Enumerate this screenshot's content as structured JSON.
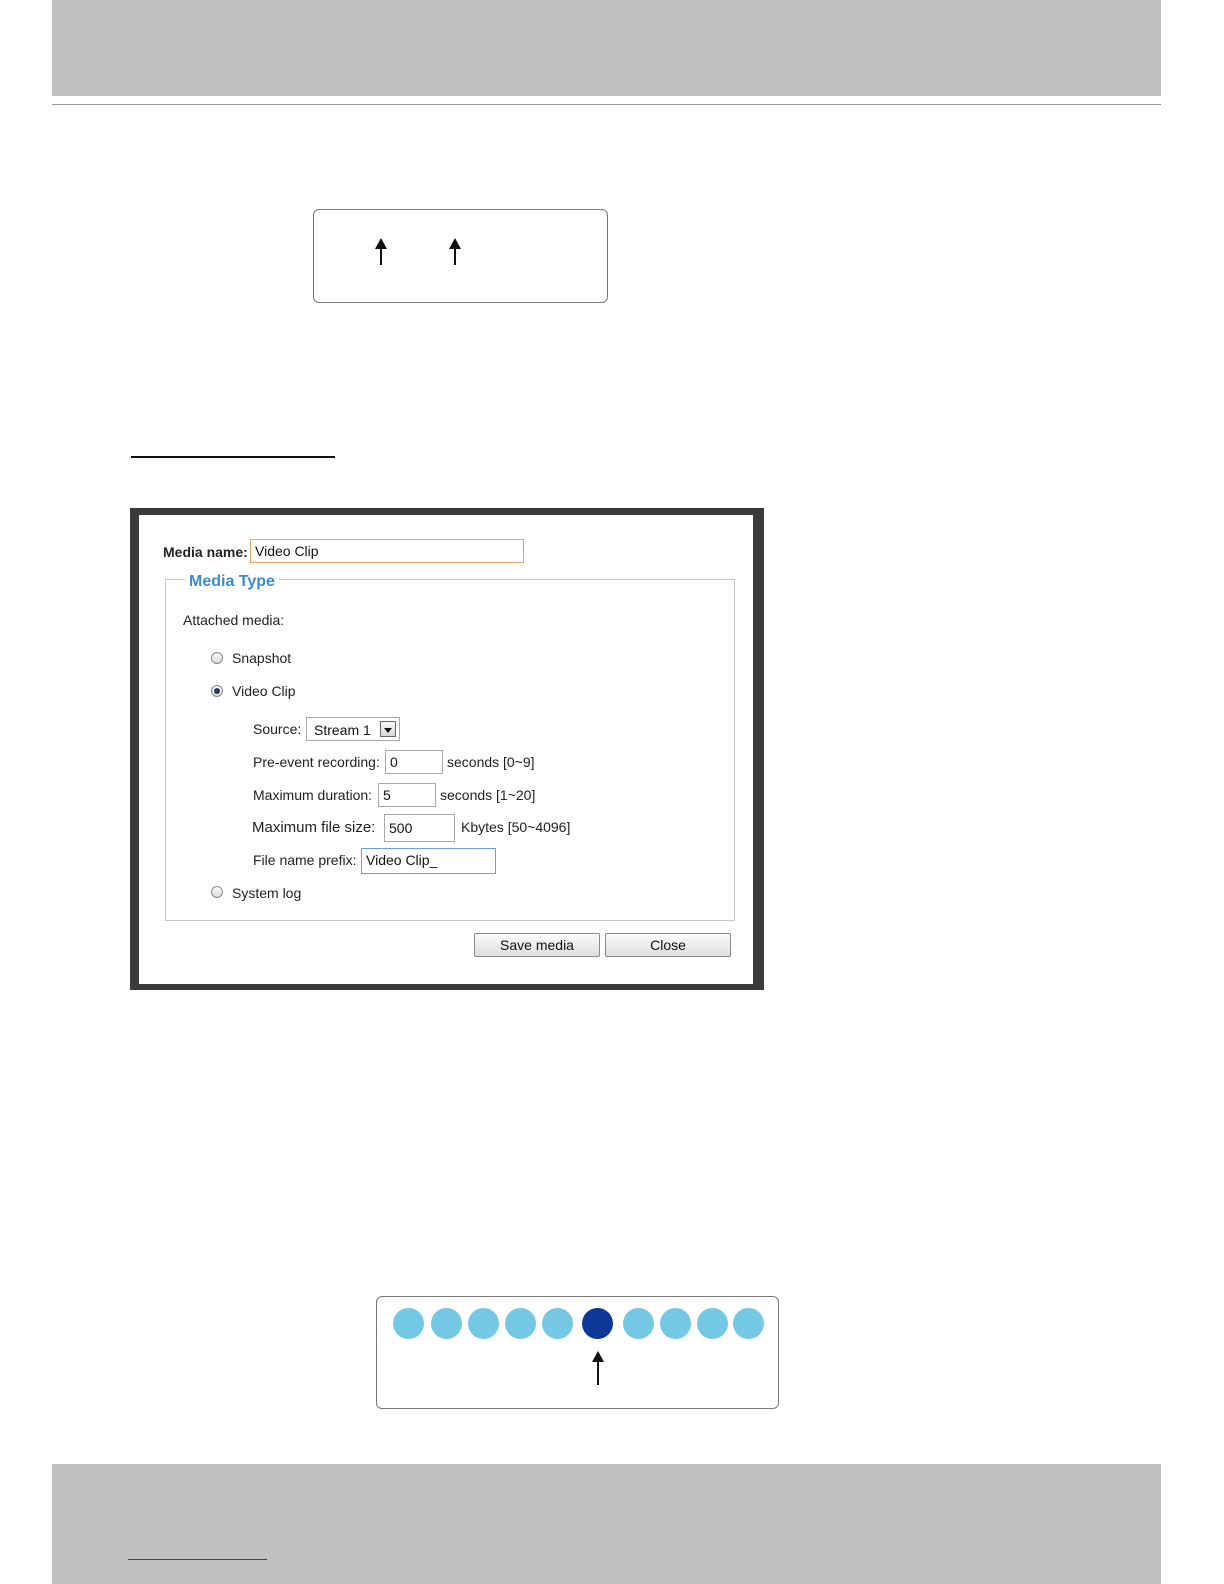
{
  "dialog": {
    "media_name_label": "Media name:",
    "media_name_value": "Video Clip",
    "legend": "Media Type",
    "attached_media_label": "Attached media:",
    "options": {
      "snapshot": "Snapshot",
      "video_clip": "Video Clip",
      "system_log": "System log"
    },
    "selected_option": "video_clip",
    "source": {
      "label": "Source:",
      "value": "Stream 1"
    },
    "pre_event": {
      "label": "Pre-event recording:",
      "value": "0",
      "unit": "seconds [0~9]"
    },
    "max_duration": {
      "label": "Maximum duration:",
      "value": "5",
      "unit": "seconds [1~20]"
    },
    "max_file_size": {
      "label": "Maximum file size:",
      "value": "500",
      "unit": "Kbytes [50~4096]"
    },
    "prefix": {
      "label": "File name prefix:",
      "value": "Video Clip_"
    },
    "buttons": {
      "save": "Save media",
      "close": "Close"
    }
  },
  "colors": {
    "header_bar": "#c0c0c0",
    "legend_text": "#3b8bd1",
    "dot_inactive": "#74c8e4",
    "dot_active": "#0d3898"
  },
  "indicator": {
    "count": 10,
    "active_index": 5
  }
}
